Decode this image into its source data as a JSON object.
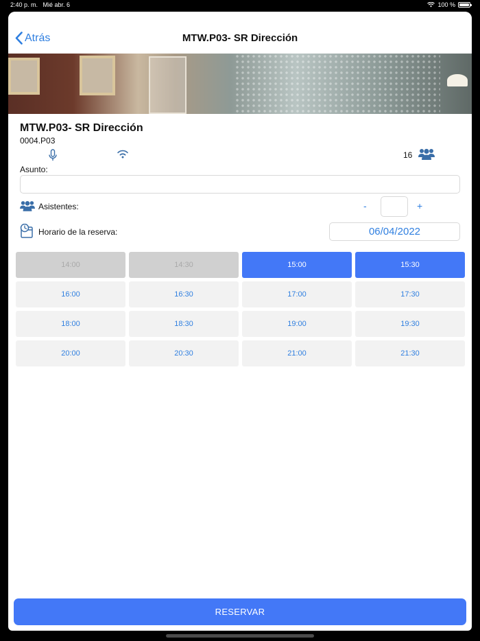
{
  "status_bar": {
    "time": "2:40 p. m.",
    "date": "Mié abr. 6",
    "battery": "100 %"
  },
  "nav": {
    "back_label": "Atrás",
    "title": "MTW.P03- SR Dirección"
  },
  "room": {
    "name": "MTW.P03- SR Dirección",
    "code": "0004.P03",
    "capacity": "16"
  },
  "form": {
    "subject_label": "Asunto:",
    "subject_value": "",
    "attendees_label": "Asistentes:",
    "attendees_value": "",
    "minus": "-",
    "plus": "+",
    "schedule_label": "Horario de la reserva:",
    "date": "06/04/2022"
  },
  "slots": [
    {
      "time": "14:00",
      "state": "disabled"
    },
    {
      "time": "14:30",
      "state": "disabled"
    },
    {
      "time": "15:00",
      "state": "selected"
    },
    {
      "time": "15:30",
      "state": "selected"
    },
    {
      "time": "16:00",
      "state": "available"
    },
    {
      "time": "16:30",
      "state": "available"
    },
    {
      "time": "17:00",
      "state": "available"
    },
    {
      "time": "17:30",
      "state": "available"
    },
    {
      "time": "18:00",
      "state": "available"
    },
    {
      "time": "18:30",
      "state": "available"
    },
    {
      "time": "19:00",
      "state": "available"
    },
    {
      "time": "19:30",
      "state": "available"
    },
    {
      "time": "20:00",
      "state": "available"
    },
    {
      "time": "20:30",
      "state": "available"
    },
    {
      "time": "21:00",
      "state": "available"
    },
    {
      "time": "21:30",
      "state": "available"
    }
  ],
  "reserve_label": "RESERVAR",
  "colors": {
    "accent": "#4378f7",
    "link": "#2f7fe0",
    "icon": "#3a6ea8",
    "disabled": "#d0d0d0"
  },
  "icons": [
    "chevron-left-icon",
    "microphone-icon",
    "wifi-icon",
    "people-icon",
    "calendar-clock-icon",
    "battery-icon"
  ]
}
